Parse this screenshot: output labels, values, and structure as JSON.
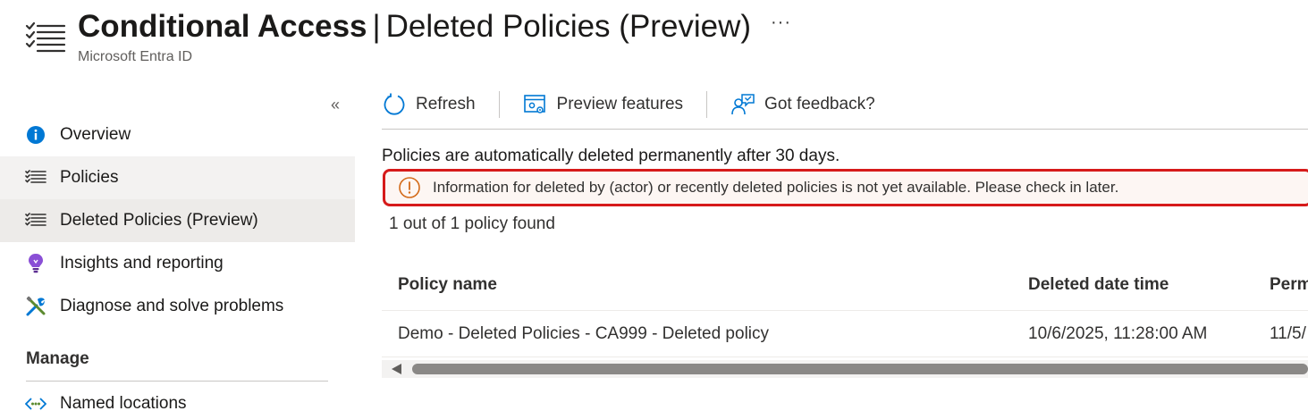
{
  "header": {
    "title_strong": "Conditional Access",
    "separator": "|",
    "title_rest": "Deleted Policies (Preview)",
    "subtitle": "Microsoft Entra ID",
    "more_label": "···",
    "icon": "list-icon"
  },
  "sidebar": {
    "collapse_label": "«",
    "items": [
      {
        "label": "Overview",
        "icon": "info-icon"
      },
      {
        "label": "Policies",
        "icon": "list-icon"
      },
      {
        "label": "Deleted Policies (Preview)",
        "icon": "list-icon"
      },
      {
        "label": "Insights and reporting",
        "icon": "lightbulb-icon"
      },
      {
        "label": "Diagnose and solve problems",
        "icon": "wrench-icon"
      }
    ],
    "section_title": "Manage",
    "manage_items": [
      {
        "label": "Named locations",
        "icon": "named-locations-icon"
      }
    ]
  },
  "toolbar": {
    "refresh_label": "Refresh",
    "preview_label": "Preview features",
    "feedback_label": "Got feedback?"
  },
  "main": {
    "notice": "Policies are automatically deleted permanently after 30 days.",
    "banner_text": "Information for deleted by (actor) or recently deleted policies is not yet available. Please check in later.",
    "count": "1 out of 1 policy found"
  },
  "table": {
    "columns": [
      "Policy name",
      "Deleted date time",
      "Perm"
    ],
    "rows": [
      [
        "Demo - Deleted Policies - CA999 - Deleted policy",
        "10/6/2025, 11:28:00 AM",
        "11/5/"
      ]
    ]
  },
  "colors": {
    "accent": "#0078d4",
    "banner_border": "#d61a1a",
    "banner_background": "#fdf6f3",
    "warning_icon": "#d36a19",
    "selected_background": "#edebe9"
  }
}
